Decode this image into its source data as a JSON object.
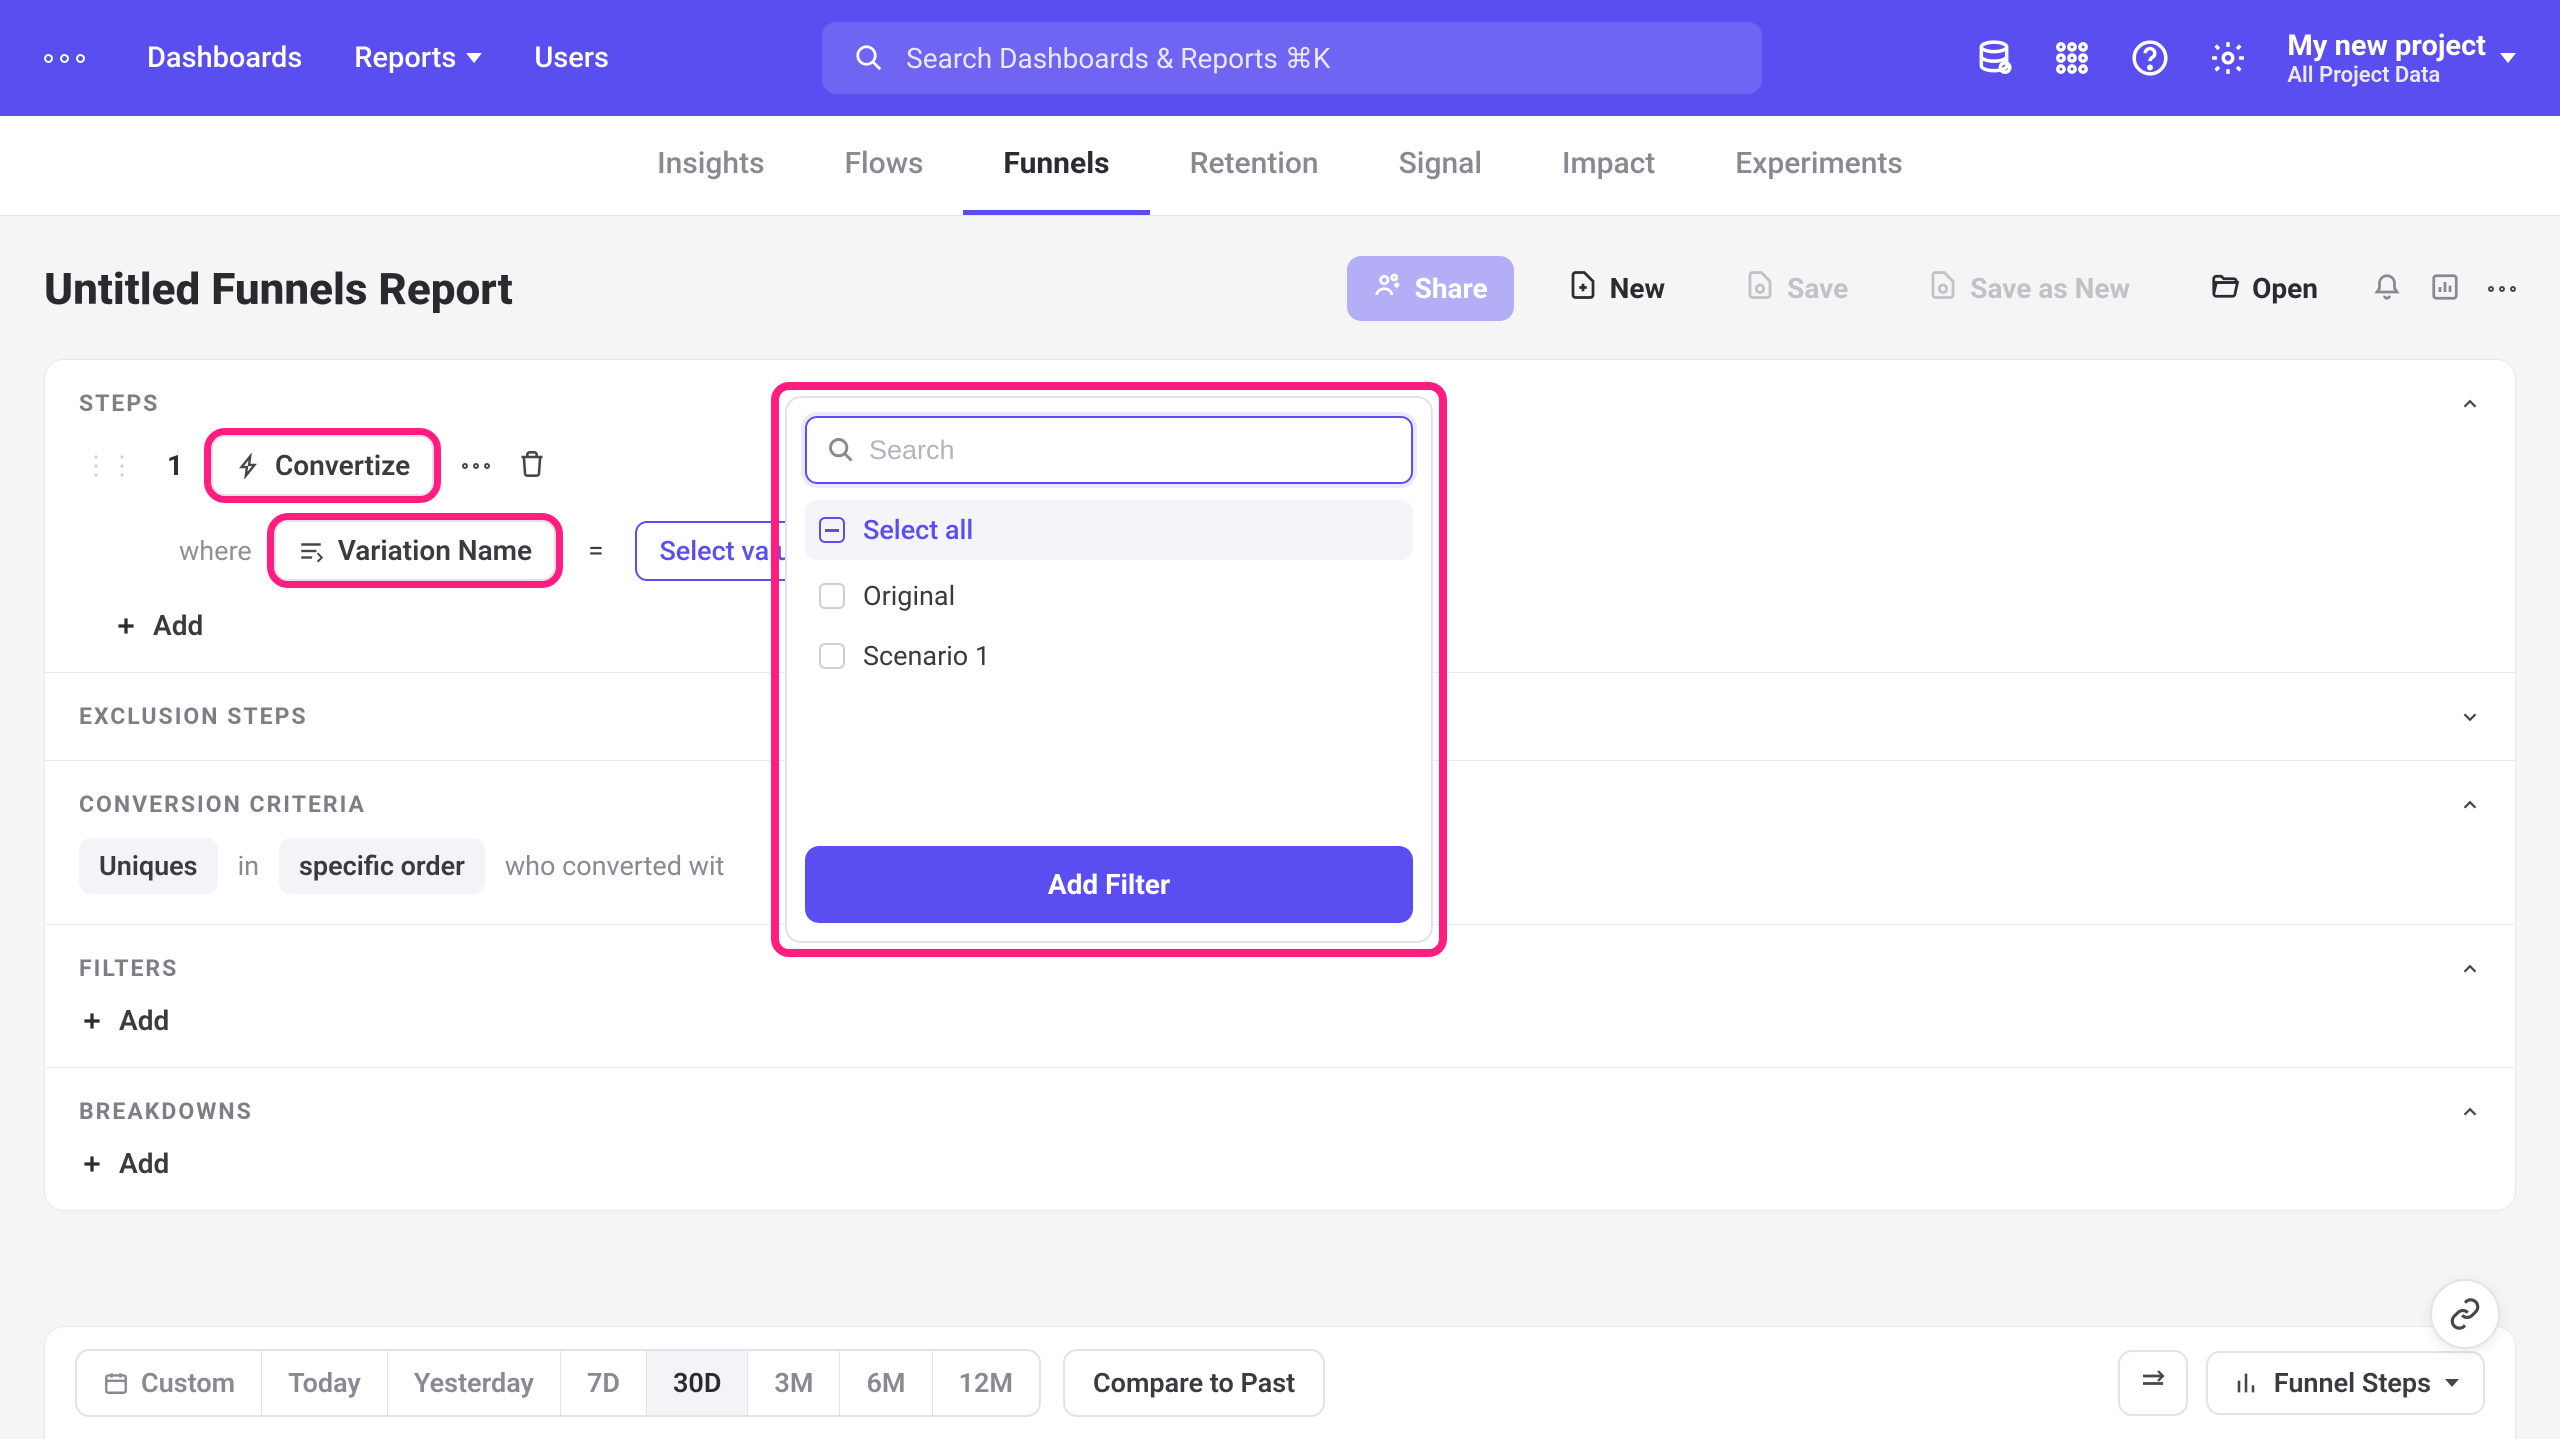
{
  "header": {
    "nav": {
      "dashboards": "Dashboards",
      "reports": "Reports",
      "users": "Users"
    },
    "search_placeholder": "Search Dashboards & Reports ⌘K",
    "project_name": "My new project",
    "project_sub": "All Project Data"
  },
  "tabs": {
    "insights": "Insights",
    "flows": "Flows",
    "funnels": "Funnels",
    "retention": "Retention",
    "signal": "Signal",
    "impact": "Impact",
    "experiments": "Experiments"
  },
  "title": "Untitled Funnels Report",
  "actions": {
    "share": "Share",
    "new": "New",
    "save": "Save",
    "save_as": "Save as New",
    "open": "Open"
  },
  "sections": {
    "steps": "STEPS",
    "exclusion": "EXCLUSION STEPS",
    "conversion": "CONVERSION CRITERIA",
    "filters": "FILTERS",
    "breakdowns": "BREAKDOWNS"
  },
  "step": {
    "number": "1",
    "event": "Convertize",
    "where": "where",
    "property": "Variation Name",
    "equals": "=",
    "select_value": "Select value...",
    "add": "Add"
  },
  "conversion": {
    "uniques": "Uniques",
    "in": "in",
    "order": "specific order",
    "rest": "who converted wit"
  },
  "add_label": "Add",
  "popover": {
    "search_placeholder": "Search",
    "select_all": "Select all",
    "opt1": "Original",
    "opt2": "Scenario 1",
    "add_filter": "Add Filter"
  },
  "timebar": {
    "custom": "Custom",
    "today": "Today",
    "yesterday": "Yesterday",
    "d7": "7D",
    "d30": "30D",
    "m3": "3M",
    "m6": "6M",
    "m12": "12M",
    "compare": "Compare to Past",
    "funnel_steps": "Funnel Steps"
  }
}
